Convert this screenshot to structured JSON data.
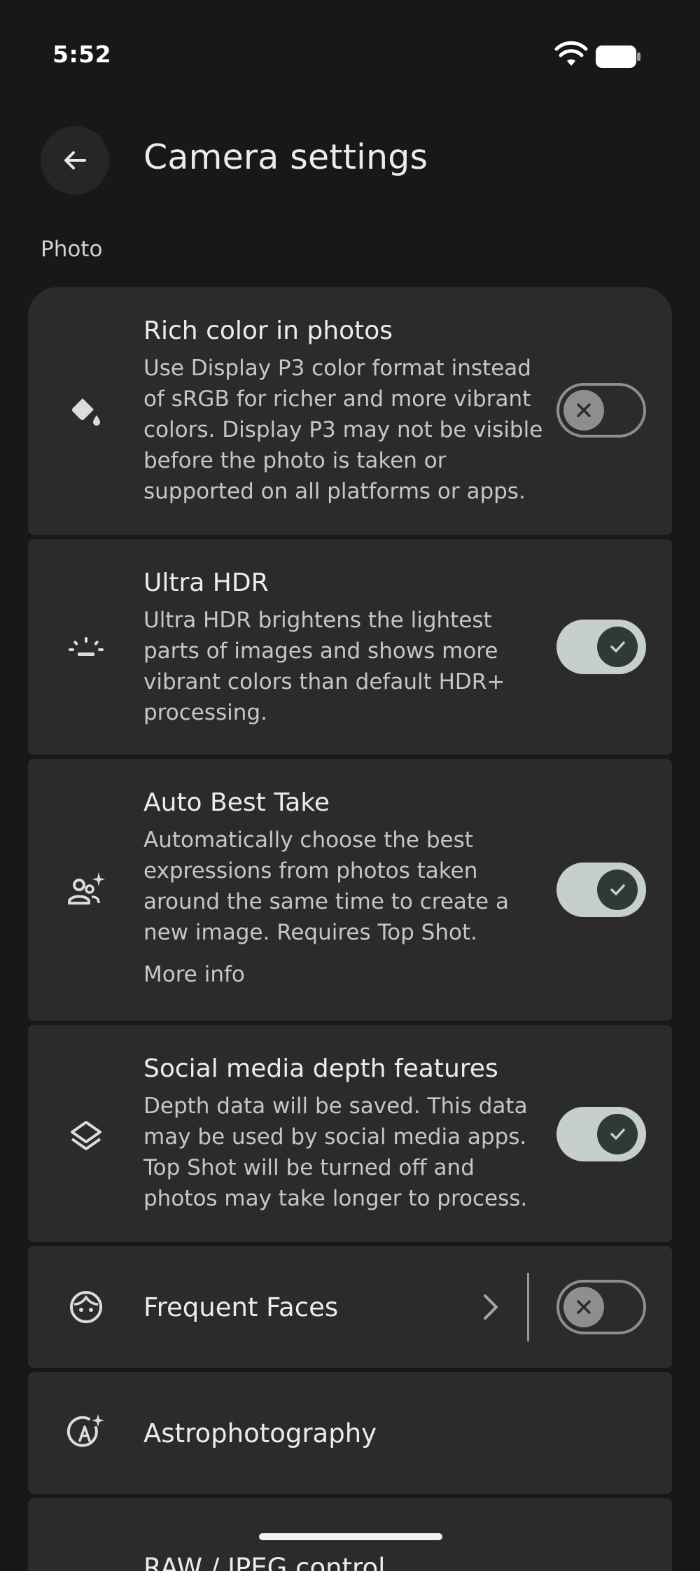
{
  "status_bar": {
    "time": "5:52"
  },
  "header": {
    "title": "Camera settings"
  },
  "section": {
    "label": "Photo"
  },
  "settings": [
    {
      "title": "Rich color in photos",
      "description": "Use Display P3 color format instead of sRGB for richer and more vibrant colors. Display P3 may not be visible before the photo is taken or supported on all platforms or apps.",
      "icon": "paint-bucket-icon",
      "toggle": false
    },
    {
      "title": "Ultra HDR",
      "description": "Ultra HDR brightens the lightest parts of images and shows more vibrant colors than default HDR+ processing.",
      "icon": "brightness-icon",
      "toggle": true
    },
    {
      "title": "Auto Best Take",
      "description": "Automatically choose the best expressions from photos taken around the same time to create a new image. Requires Top Shot.",
      "link": "More info",
      "icon": "group-sparkle-icon",
      "toggle": true
    },
    {
      "title": "Social media depth features",
      "description": "Depth data will be saved. This data may be used by social media apps. Top Shot will be turned off and photos may take longer to process.",
      "icon": "layers-icon",
      "toggle": true
    },
    {
      "title": "Frequent Faces",
      "icon": "face-icon",
      "toggle": false
    },
    {
      "title": "Astrophotography",
      "icon": "astro-icon"
    },
    {
      "title": "RAW / JPEG control",
      "icon": ""
    }
  ],
  "colors": {
    "background": "#181818",
    "card": "#2b2b2b",
    "toggle_on_track": "#c7cfca",
    "toggle_on_thumb": "#2f3a35",
    "toggle_off": "#8e8e8e"
  }
}
